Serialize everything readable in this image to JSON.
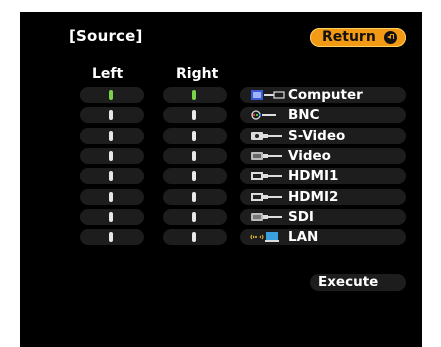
{
  "title": "[Source]",
  "return_button": {
    "label": "Return",
    "icon": "enter-icon"
  },
  "columns": {
    "left": "Left",
    "right": "Right"
  },
  "sources": [
    {
      "label": "Computer",
      "icon": "computer-port-icon",
      "left_selected": true,
      "right_selected": true
    },
    {
      "label": "BNC",
      "icon": "bnc-port-icon",
      "left_selected": false,
      "right_selected": false
    },
    {
      "label": "S-Video",
      "icon": "svideo-port-icon",
      "left_selected": false,
      "right_selected": false
    },
    {
      "label": "Video",
      "icon": "video-port-icon",
      "left_selected": false,
      "right_selected": false
    },
    {
      "label": "HDMI1",
      "icon": "hdmi-port-icon",
      "left_selected": false,
      "right_selected": false
    },
    {
      "label": "HDMI2",
      "icon": "hdmi-port-icon",
      "left_selected": false,
      "right_selected": false
    },
    {
      "label": "SDI",
      "icon": "sdi-port-icon",
      "left_selected": false,
      "right_selected": false
    },
    {
      "label": "LAN",
      "icon": "lan-wireless-icon",
      "left_selected": false,
      "right_selected": false
    }
  ],
  "execute_button": {
    "label": "Execute"
  },
  "colors": {
    "accent": "#f29a14",
    "selected": "#7ad24a",
    "slot": "#1d1d1d",
    "background": "#000000"
  }
}
